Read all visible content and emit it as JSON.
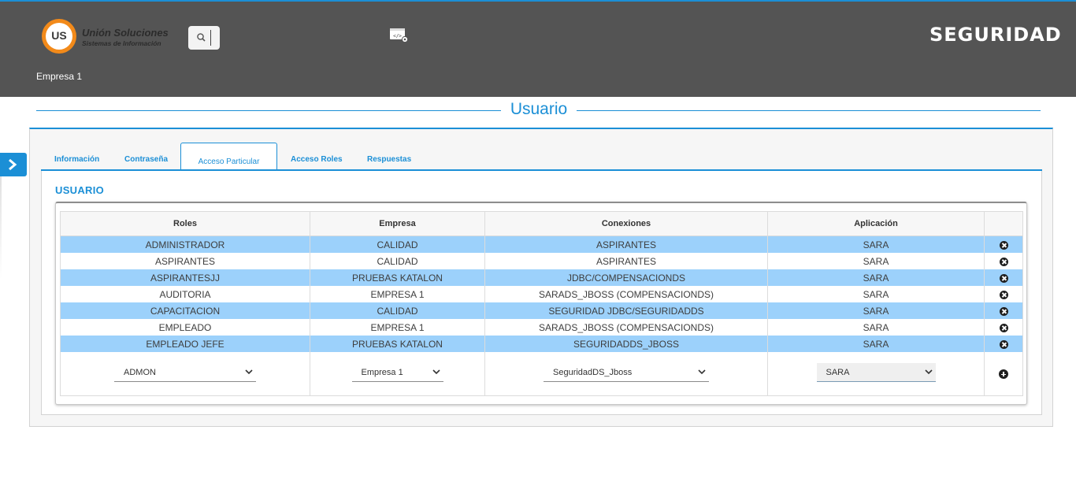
{
  "header": {
    "logo": {
      "title": "Unión Soluciones",
      "subtitle": "Sistemas de Información",
      "mark": "US"
    },
    "brand": "SEGURIDAD",
    "company": "Empresa 1",
    "icons": [
      "search-icon",
      "code-settings-icon",
      "chevron-right-icon"
    ]
  },
  "page": {
    "title": "Usuario",
    "tabs": [
      "Información",
      "Contraseña",
      "Acceso Particular",
      "Acceso Roles",
      "Respuestas"
    ],
    "active_tab": "Acceso Particular",
    "section_title": "USUARIO"
  },
  "table": {
    "columns": [
      "Roles",
      "Empresa",
      "Conexiones",
      "Aplicación",
      ""
    ],
    "rows": [
      {
        "role": "ADMINISTRADOR",
        "empresa": "CALIDAD",
        "conexion": "ASPIRANTES",
        "aplicacion": "SARA"
      },
      {
        "role": "ASPIRANTES",
        "empresa": "CALIDAD",
        "conexion": "ASPIRANTES",
        "aplicacion": "SARA"
      },
      {
        "role": "ASPIRANTESJJ",
        "empresa": "PRUEBAS KATALON",
        "conexion": "JDBC/COMPENSACIONDS",
        "aplicacion": "SARA"
      },
      {
        "role": "AUDITORIA",
        "empresa": "EMPRESA 1",
        "conexion": "SARADS_JBOSS (COMPENSACIONDS)",
        "aplicacion": "SARA"
      },
      {
        "role": "CAPACITACION",
        "empresa": "CALIDAD",
        "conexion": "SEGURIDAD JDBC/SEGURIDADDS",
        "aplicacion": "SARA"
      },
      {
        "role": "EMPLEADO",
        "empresa": "EMPRESA 1",
        "conexion": "SARADS_JBOSS (COMPENSACIONDS)",
        "aplicacion": "SARA"
      },
      {
        "role": "EMPLEADO JEFE",
        "empresa": "PRUEBAS KATALON",
        "conexion": "SEGURIDADDS_JBOSS",
        "aplicacion": "SARA"
      }
    ],
    "form": {
      "role_select": "ADMON",
      "empresa_select": "Empresa 1",
      "conexion_select": "SeguridadDS_Jboss",
      "aplicacion_select": "SARA"
    }
  },
  "colors": {
    "accent": "#1b8fd6",
    "header_bg": "#545454",
    "row_highlight": "#9cd1fb",
    "logo_orange": "#f28a1a"
  }
}
